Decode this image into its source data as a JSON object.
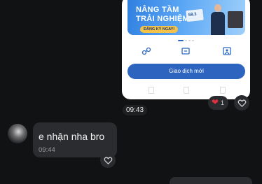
{
  "shared_screenshot": {
    "banner": {
      "headline_line1": "NÂNG TẦM",
      "headline_line2": "TRẢI NGHIỆM",
      "cta_label": "ĐĂNG KÝ NGAY!",
      "card_text": "58.3"
    },
    "quick_actions": [
      "transfer-icon",
      "scan-icon",
      "profile-icon"
    ],
    "primary_button_label": "Giao dịch mới"
  },
  "messages": [
    {
      "id": "incoming-image",
      "timestamp": "09:43",
      "reaction": {
        "emoji_icon": "heart-icon",
        "color": "#e0303c",
        "count": "1"
      }
    },
    {
      "id": "incoming-text",
      "text": "e nhận nha bro",
      "time": "09:44"
    }
  ],
  "colors": {
    "background": "#111214",
    "bubble": "#2b2c2f",
    "primary_blue": "#2c64bf",
    "reaction_heart": "#e0303c"
  }
}
